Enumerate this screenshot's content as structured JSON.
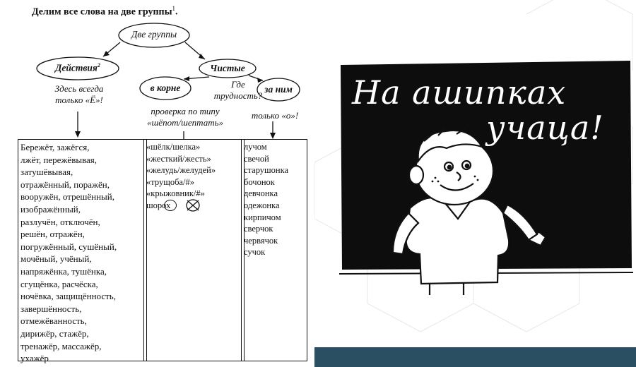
{
  "heading": {
    "text": "Делим все слова на две группы",
    "sup": "1",
    "end": "."
  },
  "diagram": {
    "root": "Две группы",
    "actions": "Действия",
    "actions_sup": "2",
    "clean": "Чистые",
    "in_root": "в корне",
    "after_it": "за ним",
    "where_difficulty": [
      "Где",
      "трудность?"
    ],
    "always_yo": [
      "Здесь всегда",
      "только «Ё»!"
    ],
    "check_type": [
      "проверка по типу",
      "«шёпот/шептать»"
    ],
    "only_o": "только «о»!"
  },
  "table": {
    "col1": [
      "Бережёт, зажёгся,",
      "лжёт, пережёвывая,",
      "затушёвывая,",
      "отражённый, поражён,",
      "вооружён, отрешённый,",
      "изображённый,",
      "разлучён, отключён,",
      "решён, отражён,",
      "погружённый, сушёный,",
      "мочёный, учёный,",
      "напряжёнка, тушёнка,",
      "сгущёнка, расчёска,",
      "ночёвка, защищённость,",
      "завершённость,",
      "отмежёванность,",
      "дирижёр, стажёр,",
      "тренажёр, массажёр,",
      "ухажёр"
    ],
    "col2": [
      "«шёлк/шелка»",
      "«жесткий/жесть»",
      "«желудь/желудей»",
      "«трущоба/#»",
      "«крыжовник/#»",
      "шорох"
    ],
    "col3": [
      "лучом",
      "свечой",
      "старушонка",
      "бочонок",
      "девчонка",
      "одежонка",
      "кирпичом",
      "сверчок",
      "червячок",
      "сучок"
    ]
  },
  "illustration": {
    "board_line1": "На ашипках",
    "board_line2": "учаца!"
  },
  "colors": {
    "footer": "#2a4f63",
    "board": "#0d0d0d"
  }
}
